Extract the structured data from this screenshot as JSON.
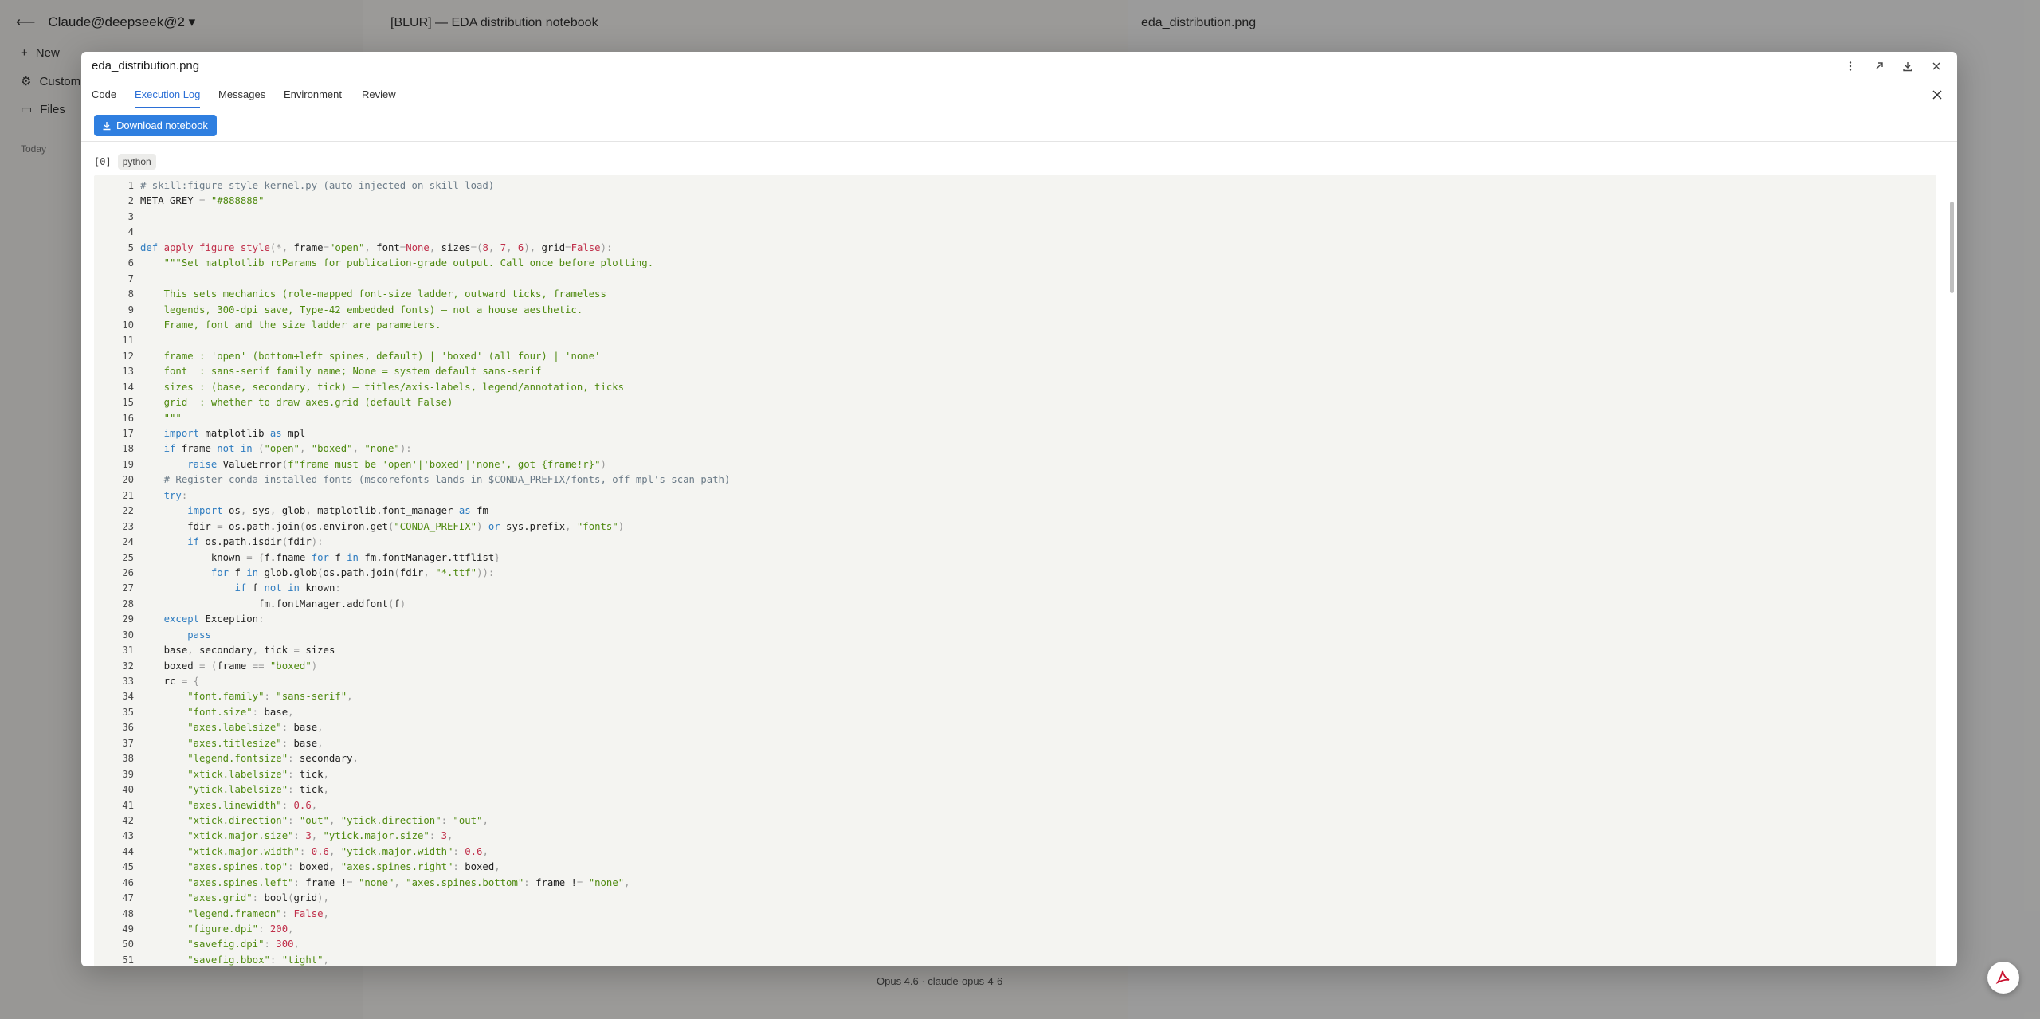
{
  "background": {
    "sidebar_title": "Claude@deepseek@2 ▾",
    "sidebar_items": [
      "New",
      "Customize",
      "Files"
    ],
    "sidebar_section": "Today",
    "main_title": "[BLUR] — EDA distribution notebook",
    "right_panel_title": "eda_distribution.png",
    "footer_text": "Opus 4.6 · claude-opus-4-6"
  },
  "modal": {
    "title": "eda_distribution.png",
    "actions": [
      {
        "name": "more-options-icon",
        "label": "More options"
      },
      {
        "name": "open-external-icon",
        "label": "Open in new window"
      },
      {
        "name": "download-icon",
        "label": "Download"
      },
      {
        "name": "close-icon",
        "label": "Close"
      }
    ],
    "tabs": [
      {
        "label": "Code",
        "active": false
      },
      {
        "label": "Execution Log",
        "active": true
      },
      {
        "label": "Messages",
        "active": false
      },
      {
        "label": "Environment",
        "active": false
      },
      {
        "label": "Review",
        "active": false
      }
    ],
    "download_button": "Download notebook",
    "cell": {
      "index": "[0]",
      "language": "python",
      "lines": [
        "# skill:figure-style kernel.py (auto-injected on skill load)",
        "META_GREY = \"#888888\"",
        "",
        "",
        "def apply_figure_style(*, frame=\"open\", font=None, sizes=(8, 7, 6), grid=False):",
        "    \"\"\"Set matplotlib rcParams for publication-grade output. Call once before plotting.",
        "",
        "    This sets mechanics (role-mapped font-size ladder, outward ticks, frameless",
        "    legends, 300-dpi save, Type-42 embedded fonts) — not a house aesthetic.",
        "    Frame, font and the size ladder are parameters.",
        "",
        "    frame : 'open' (bottom+left spines, default) | 'boxed' (all four) | 'none'",
        "    font  : sans-serif family name; None = system default sans-serif",
        "    sizes : (base, secondary, tick) — titles/axis-labels, legend/annotation, ticks",
        "    grid  : whether to draw axes.grid (default False)",
        "    \"\"\"",
        "    import matplotlib as mpl",
        "    if frame not in (\"open\", \"boxed\", \"none\"):",
        "        raise ValueError(f\"frame must be 'open'|'boxed'|'none', got {frame!r}\")",
        "    # Register conda-installed fonts (mscorefonts lands in $CONDA_PREFIX/fonts, off mpl's scan path)",
        "    try:",
        "        import os, sys, glob, matplotlib.font_manager as fm",
        "        fdir = os.path.join(os.environ.get(\"CONDA_PREFIX\") or sys.prefix, \"fonts\")",
        "        if os.path.isdir(fdir):",
        "            known = {f.fname for f in fm.fontManager.ttflist}",
        "            for f in glob.glob(os.path.join(fdir, \"*.ttf\")):",
        "                if f not in known:",
        "                    fm.fontManager.addfont(f)",
        "    except Exception:",
        "        pass",
        "    base, secondary, tick = sizes",
        "    boxed = (frame == \"boxed\")",
        "    rc = {",
        "        \"font.family\": \"sans-serif\",",
        "        \"font.size\": base,",
        "        \"axes.labelsize\": base,",
        "        \"axes.titlesize\": base,",
        "        \"legend.fontsize\": secondary,",
        "        \"xtick.labelsize\": tick,",
        "        \"ytick.labelsize\": tick,",
        "        \"axes.linewidth\": 0.6,",
        "        \"xtick.direction\": \"out\", \"ytick.direction\": \"out\",",
        "        \"xtick.major.size\": 3, \"ytick.major.size\": 3,",
        "        \"xtick.major.width\": 0.6, \"ytick.major.width\": 0.6,",
        "        \"axes.spines.top\": boxed, \"axes.spines.right\": boxed,",
        "        \"axes.spines.left\": frame != \"none\", \"axes.spines.bottom\": frame != \"none\",",
        "        \"axes.grid\": bool(grid),",
        "        \"legend.frameon\": False,",
        "        \"figure.dpi\": 200,",
        "        \"savefig.dpi\": 300,",
        "        \"savefig.bbox\": \"tight\","
      ]
    }
  },
  "colors": {
    "accent": "#2f7fe0",
    "active_tab": "#2b6fd6",
    "code_bg": "#f4f4f1",
    "overlay": "rgba(0,0,0,0.38)"
  }
}
